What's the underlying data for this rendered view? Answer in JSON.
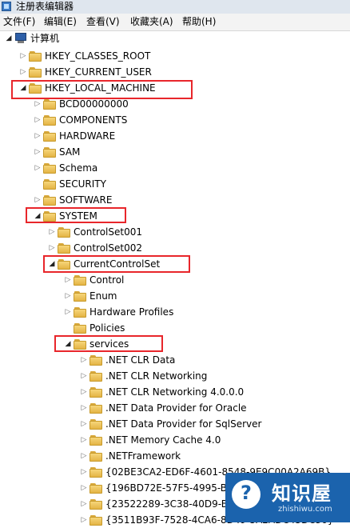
{
  "window": {
    "title": "注册表编辑器",
    "icon": "registry-icon"
  },
  "menu": [
    "文件(F)",
    "编辑(E)",
    "查看(V)",
    "收藏夹(A)",
    "帮助(H)"
  ],
  "tree": [
    {
      "label": "计算机",
      "icon": "computer-icon",
      "toggle": "expanded"
    },
    {
      "label": "HKEY_CLASSES_ROOT",
      "icon": "folder-icon",
      "toggle": "collapsed"
    },
    {
      "label": "HKEY_CURRENT_USER",
      "icon": "folder-icon",
      "toggle": "collapsed"
    },
    {
      "label": "HKEY_LOCAL_MACHINE",
      "icon": "folder-icon",
      "toggle": "expanded",
      "highlighted": true
    },
    {
      "label": "BCD00000000",
      "icon": "folder-icon",
      "toggle": "collapsed"
    },
    {
      "label": "COMPONENTS",
      "icon": "folder-icon",
      "toggle": "collapsed"
    },
    {
      "label": "HARDWARE",
      "icon": "folder-icon",
      "toggle": "collapsed"
    },
    {
      "label": "SAM",
      "icon": "folder-icon",
      "toggle": "collapsed"
    },
    {
      "label": "Schema",
      "icon": "folder-icon",
      "toggle": "collapsed"
    },
    {
      "label": "SECURITY",
      "icon": "folder-icon",
      "toggle": "none"
    },
    {
      "label": "SOFTWARE",
      "icon": "folder-icon",
      "toggle": "collapsed"
    },
    {
      "label": "SYSTEM",
      "icon": "folder-icon",
      "toggle": "expanded",
      "highlighted": true
    },
    {
      "label": "ControlSet001",
      "icon": "folder-icon",
      "toggle": "collapsed"
    },
    {
      "label": "ControlSet002",
      "icon": "folder-icon",
      "toggle": "collapsed"
    },
    {
      "label": "CurrentControlSet",
      "icon": "folder-icon",
      "toggle": "expanded",
      "highlighted": true
    },
    {
      "label": "Control",
      "icon": "folder-icon",
      "toggle": "collapsed"
    },
    {
      "label": "Enum",
      "icon": "folder-icon",
      "toggle": "collapsed"
    },
    {
      "label": "Hardware Profiles",
      "icon": "folder-icon",
      "toggle": "collapsed"
    },
    {
      "label": "Policies",
      "icon": "folder-icon",
      "toggle": "none"
    },
    {
      "label": "services",
      "icon": "folder-icon",
      "toggle": "expanded",
      "highlighted": true
    },
    {
      "label": ".NET CLR Data",
      "icon": "folder-icon",
      "toggle": "collapsed"
    },
    {
      "label": ".NET CLR Networking",
      "icon": "folder-icon",
      "toggle": "collapsed"
    },
    {
      "label": ".NET CLR Networking 4.0.0.0",
      "icon": "folder-icon",
      "toggle": "collapsed"
    },
    {
      "label": ".NET Data Provider for Oracle",
      "icon": "folder-icon",
      "toggle": "collapsed"
    },
    {
      "label": ".NET Data Provider for SqlServer",
      "icon": "folder-icon",
      "toggle": "collapsed"
    },
    {
      "label": ".NET Memory Cache 4.0",
      "icon": "folder-icon",
      "toggle": "collapsed"
    },
    {
      "label": ".NETFramework",
      "icon": "folder-icon",
      "toggle": "collapsed"
    },
    {
      "label": "{02BE3CA2-ED6F-4601-8548-9E9C00A2A69B}",
      "icon": "folder-icon",
      "toggle": "collapsed"
    },
    {
      "label": "{196BD72E-57F5-4995-BA4D-0FE2B72F0C4B}",
      "icon": "folder-icon",
      "toggle": "collapsed"
    },
    {
      "label": "{23522289-3C38-40D9-BB6E-2E1E6E2C8D24}",
      "icon": "folder-icon",
      "toggle": "collapsed"
    },
    {
      "label": "{3511B93F-7528-4CA6-8D49-5A2ADC45DC30}",
      "icon": "folder-icon",
      "toggle": "collapsed"
    }
  ],
  "watermark": {
    "title": "知识屋",
    "url": "zhishiwu.com",
    "icon": "question-icon"
  }
}
